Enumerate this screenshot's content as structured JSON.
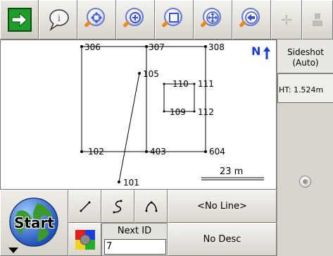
{
  "toolbar": {
    "buttons": [
      {
        "name": "exit-arrow-icon"
      },
      {
        "name": "info-balloon-icon"
      },
      {
        "name": "zoom-extents-icon"
      },
      {
        "name": "zoom-in-icon"
      },
      {
        "name": "zoom-window-icon"
      },
      {
        "name": "pan-icon"
      },
      {
        "name": "zoom-previous-icon"
      },
      {
        "name": "tool-disabled-icon"
      },
      {
        "name": "tool-disabled-icon-2"
      }
    ]
  },
  "map": {
    "north_label": "N",
    "scale_label": "23 m",
    "points": [
      {
        "id": "306"
      },
      {
        "id": "307"
      },
      {
        "id": "308"
      },
      {
        "id": "105"
      },
      {
        "id": "110"
      },
      {
        "id": "111"
      },
      {
        "id": "109"
      },
      {
        "id": "112"
      },
      {
        "id": "102"
      },
      {
        "id": "403"
      },
      {
        "id": "604"
      },
      {
        "id": "101"
      }
    ]
  },
  "side": {
    "mode_line1": "Sideshot",
    "mode_line2": "(Auto)",
    "ht_label": "HT: 1.524m"
  },
  "bottom": {
    "start_label": "Start",
    "line_label": "<No Line>",
    "next_id_label": "Next ID",
    "next_id_value": "7",
    "desc_label": "No Desc"
  },
  "colors": {
    "exit_green": "#1e9e2a",
    "north_blue": "#1a3ad8",
    "zoom_accent": "#3b4fd8"
  }
}
